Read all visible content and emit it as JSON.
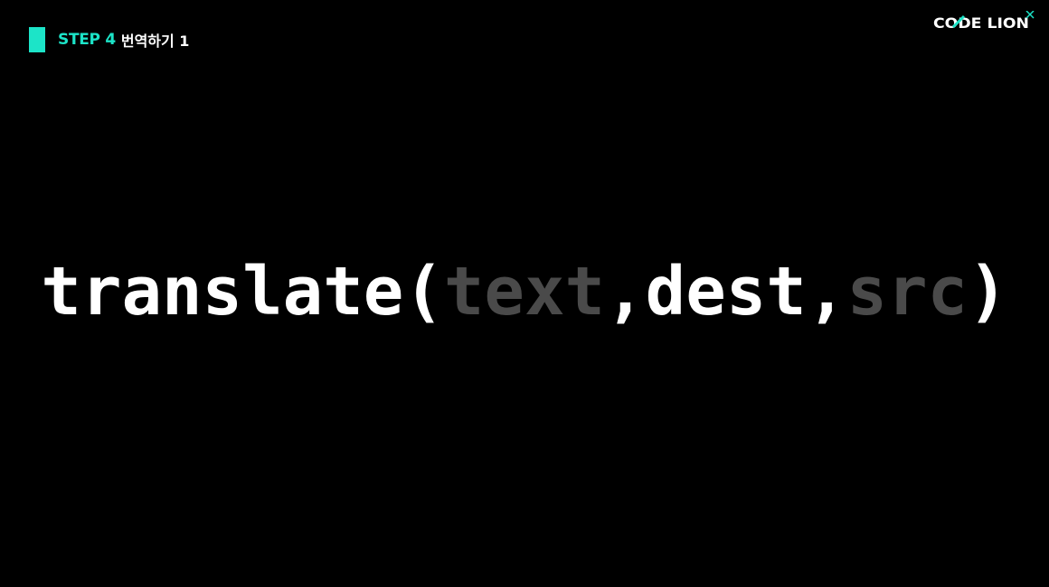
{
  "header": {
    "step_label": "STEP 4",
    "step_title": "번역하기 1",
    "accent_color": "#1ce4c8"
  },
  "logo": {
    "text": "CODE LION",
    "text_color": "#ffffff",
    "accent_color": "#1ce4c8"
  },
  "code": {
    "function_name": "translate",
    "open_paren": "(",
    "param_text": "text",
    "comma_1": ",",
    "param_dest": "dest",
    "comma_2": ",",
    "param_src": "src",
    "close_paren": ")",
    "highlight_color": "#ffffff",
    "dim_color": "#4a4a4a"
  }
}
